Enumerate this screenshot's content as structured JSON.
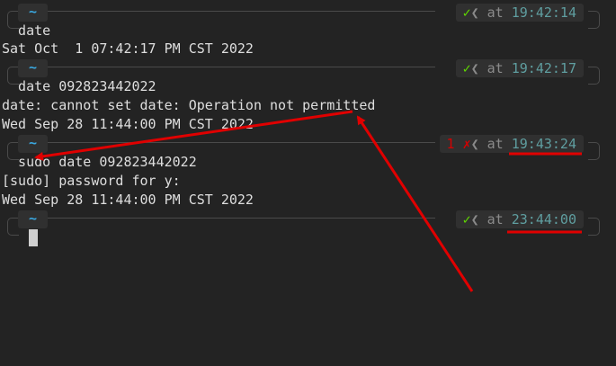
{
  "terminal": {
    "prompts": [
      {
        "dir": "~",
        "status_symbol": "✓",
        "separator": "❮",
        "at": "at",
        "time": "19:42:14",
        "exit_code": ""
      },
      {
        "dir": "~",
        "status_symbol": "✓",
        "separator": "❮",
        "at": "at",
        "time": "19:42:17",
        "exit_code": ""
      },
      {
        "dir": "~",
        "status_symbol": "✗",
        "separator": "❮",
        "at": "at",
        "time": "19:43:24",
        "exit_code": "1"
      },
      {
        "dir": "~",
        "status_symbol": "✓",
        "separator": "❮",
        "at": "at",
        "time": "23:44:00",
        "exit_code": ""
      }
    ],
    "lines": [
      "  date",
      "Sat Oct  1 07:42:17 PM CST 2022",
      "  date 092823442022",
      "date: cannot set date: Operation not permitted",
      "Wed Sep 28 11:44:00 PM CST 2022",
      "  sudo date 092823442022",
      "[sudo] password for y:",
      "Wed Sep 28 11:44:00 PM CST 2022"
    ]
  },
  "annotation_color": "#e00000"
}
